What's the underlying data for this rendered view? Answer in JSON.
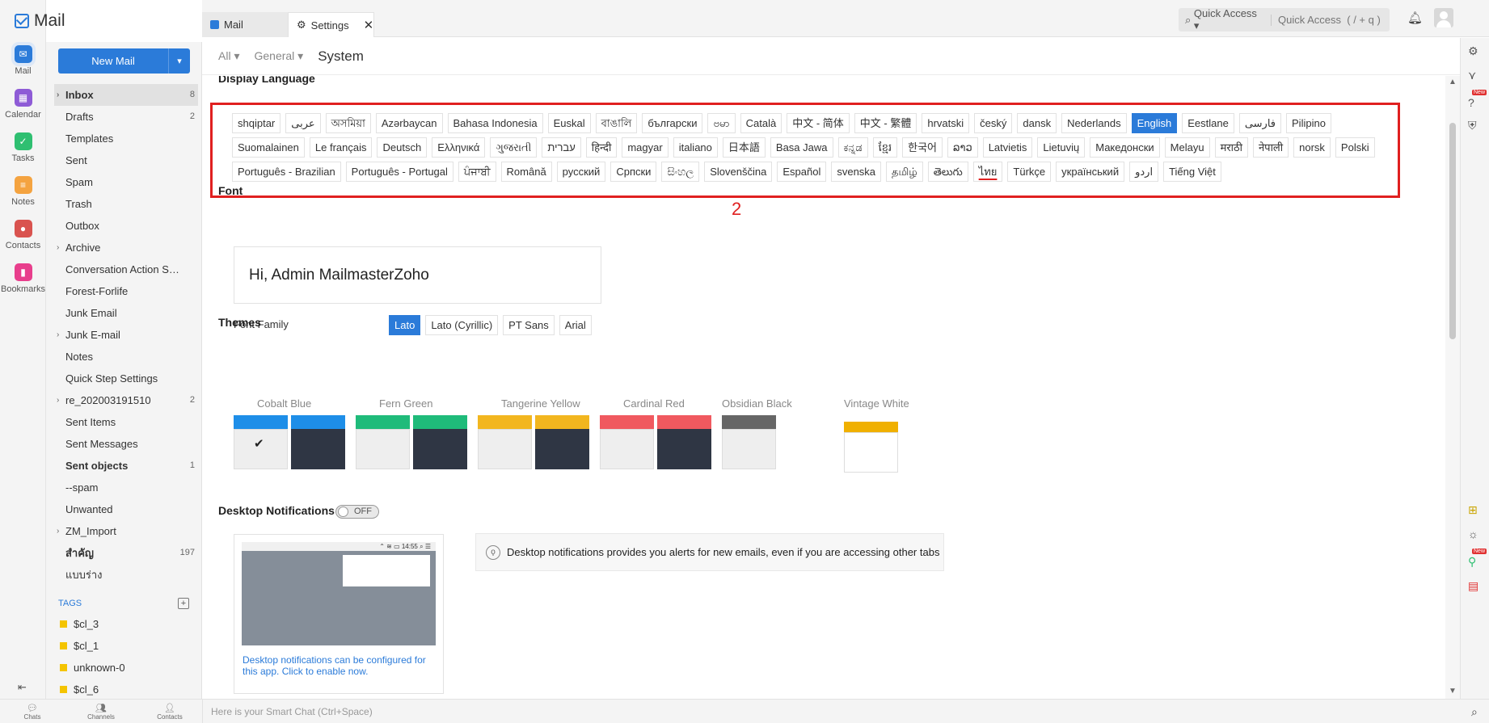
{
  "app": {
    "title": "Mail"
  },
  "rail": [
    {
      "label": "Mail",
      "icon": "mail-icon",
      "color": "#2b7bd9",
      "active": true
    },
    {
      "label": "Calendar",
      "icon": "calendar-icon",
      "color": "#8e5bd6"
    },
    {
      "label": "Tasks",
      "icon": "tasks-icon",
      "color": "#2fbf71"
    },
    {
      "label": "Notes",
      "icon": "notes-icon",
      "color": "#f4a340"
    },
    {
      "label": "Contacts",
      "icon": "contacts-icon",
      "color": "#d9534f"
    },
    {
      "label": "Bookmarks",
      "icon": "bookmarks-icon",
      "color": "#e83e8c"
    }
  ],
  "new_mail": "New Mail",
  "folders": [
    {
      "name": "Inbox",
      "count": "8",
      "bold": true,
      "selected": true,
      "caret": true
    },
    {
      "name": "Drafts",
      "count": "2"
    },
    {
      "name": "Templates"
    },
    {
      "name": "Sent"
    },
    {
      "name": "Spam"
    },
    {
      "name": "Trash"
    },
    {
      "name": "Outbox"
    },
    {
      "name": "Archive",
      "caret": true
    },
    {
      "name": "Conversation Action Sett..."
    },
    {
      "name": "Forest-Forlife"
    },
    {
      "name": "Junk Email"
    },
    {
      "name": "Junk E-mail",
      "caret": true
    },
    {
      "name": "Notes"
    },
    {
      "name": "Quick Step Settings"
    },
    {
      "name": "re_202003191510",
      "count": "2",
      "caret": true
    },
    {
      "name": "Sent Items"
    },
    {
      "name": "Sent Messages"
    },
    {
      "name": "Sent objects",
      "count": "1",
      "bold": true
    },
    {
      "name": "--spam"
    },
    {
      "name": "Unwanted"
    },
    {
      "name": "ZM_Import",
      "caret": true
    },
    {
      "name": "สำคัญ",
      "count": "197",
      "bold": true
    },
    {
      "name": "แบบร่าง"
    }
  ],
  "tags_heading": "TAGS",
  "tags": [
    "$cl_3",
    "$cl_1",
    "unknown-0",
    "$cl_6"
  ],
  "tabs": {
    "mail": "Mail",
    "settings": "Settings"
  },
  "quick_access": {
    "label": "Quick Access",
    "placeholder": "Quick Access  ( / + q )"
  },
  "breadcrumb": {
    "all": "All",
    "general": "General",
    "current": "System"
  },
  "display_language": {
    "title": "Display Language",
    "selected": "English",
    "marked": "ไทย",
    "languages": [
      "shqiptar",
      "عربى",
      "অসমিয়া",
      "Azərbaycan",
      "Bahasa Indonesia",
      "Euskal",
      "বাঙালি",
      "български",
      "ဗမာ",
      "Català",
      "中文 - 简体",
      "中文 - 繁體",
      "hrvatski",
      "český",
      "dansk",
      "Nederlands",
      "English",
      "Eestlane",
      "فارسی",
      "Pilipino",
      "Suomalainen",
      "Le français",
      "Deutsch",
      "Ελληνικά",
      "ગુજરાતી",
      "עברית",
      "हिन्दी",
      "magyar",
      "italiano",
      "日本語",
      "Basa Jawa",
      "ಕನ್ನಡ",
      "ខ្មែរ",
      "한국어",
      "ລາວ",
      "Latvietis",
      "Lietuvių",
      "Македонски",
      "Melayu",
      "मराठी",
      "नेपाली",
      "norsk",
      "Polski",
      "Português - Brazilian",
      "Português - Portugal",
      "ਪੰਜਾਬੀ",
      "Română",
      "русский",
      "Српски",
      "සිංහල",
      "Slovenščina",
      "Español",
      "svenska",
      "தமிழ்",
      "తెలుగు",
      "ไทย",
      "Türkçe",
      "український",
      "اردو",
      "Tiếng Việt"
    ]
  },
  "annotation": "2",
  "font": {
    "title": "Font",
    "preview": "Hi, Admin MailmasterZoho",
    "family_label": "Font Family",
    "families": [
      "Lato",
      "Lato (Cyrillic)",
      "PT Sans",
      "Arial"
    ],
    "selected": "Lato"
  },
  "themes": {
    "title": "Themes",
    "items": [
      {
        "name": "Cobalt Blue",
        "color": "#1e8ee8",
        "selected": true,
        "dark": true
      },
      {
        "name": "Fern Green",
        "color": "#1fbb7a",
        "dark": true
      },
      {
        "name": "Tangerine Yellow",
        "color": "#f2b61f",
        "dark": true
      },
      {
        "name": "Cardinal Red",
        "color": "#f0595f",
        "dark": true
      },
      {
        "name": "Obsidian Black",
        "color": "#666666",
        "dark": false
      },
      {
        "name": "Vintage White",
        "color": "#f0b000",
        "dark": false,
        "white": true
      }
    ]
  },
  "desktop_notifications": {
    "title": "Desktop Notifications",
    "toggle": "OFF",
    "preview_time": "14:55",
    "link": "Desktop notifications can be configured for this app. Click to enable now.",
    "info": "Desktop notifications provides you alerts for new emails, even if you are accessing other tabs"
  },
  "bottom": {
    "chats": "Chats",
    "channels": "Channels",
    "contacts": "Contacts",
    "smart_chat": "Here is your Smart Chat (Ctrl+Space)"
  },
  "right_rail_badge": "New"
}
